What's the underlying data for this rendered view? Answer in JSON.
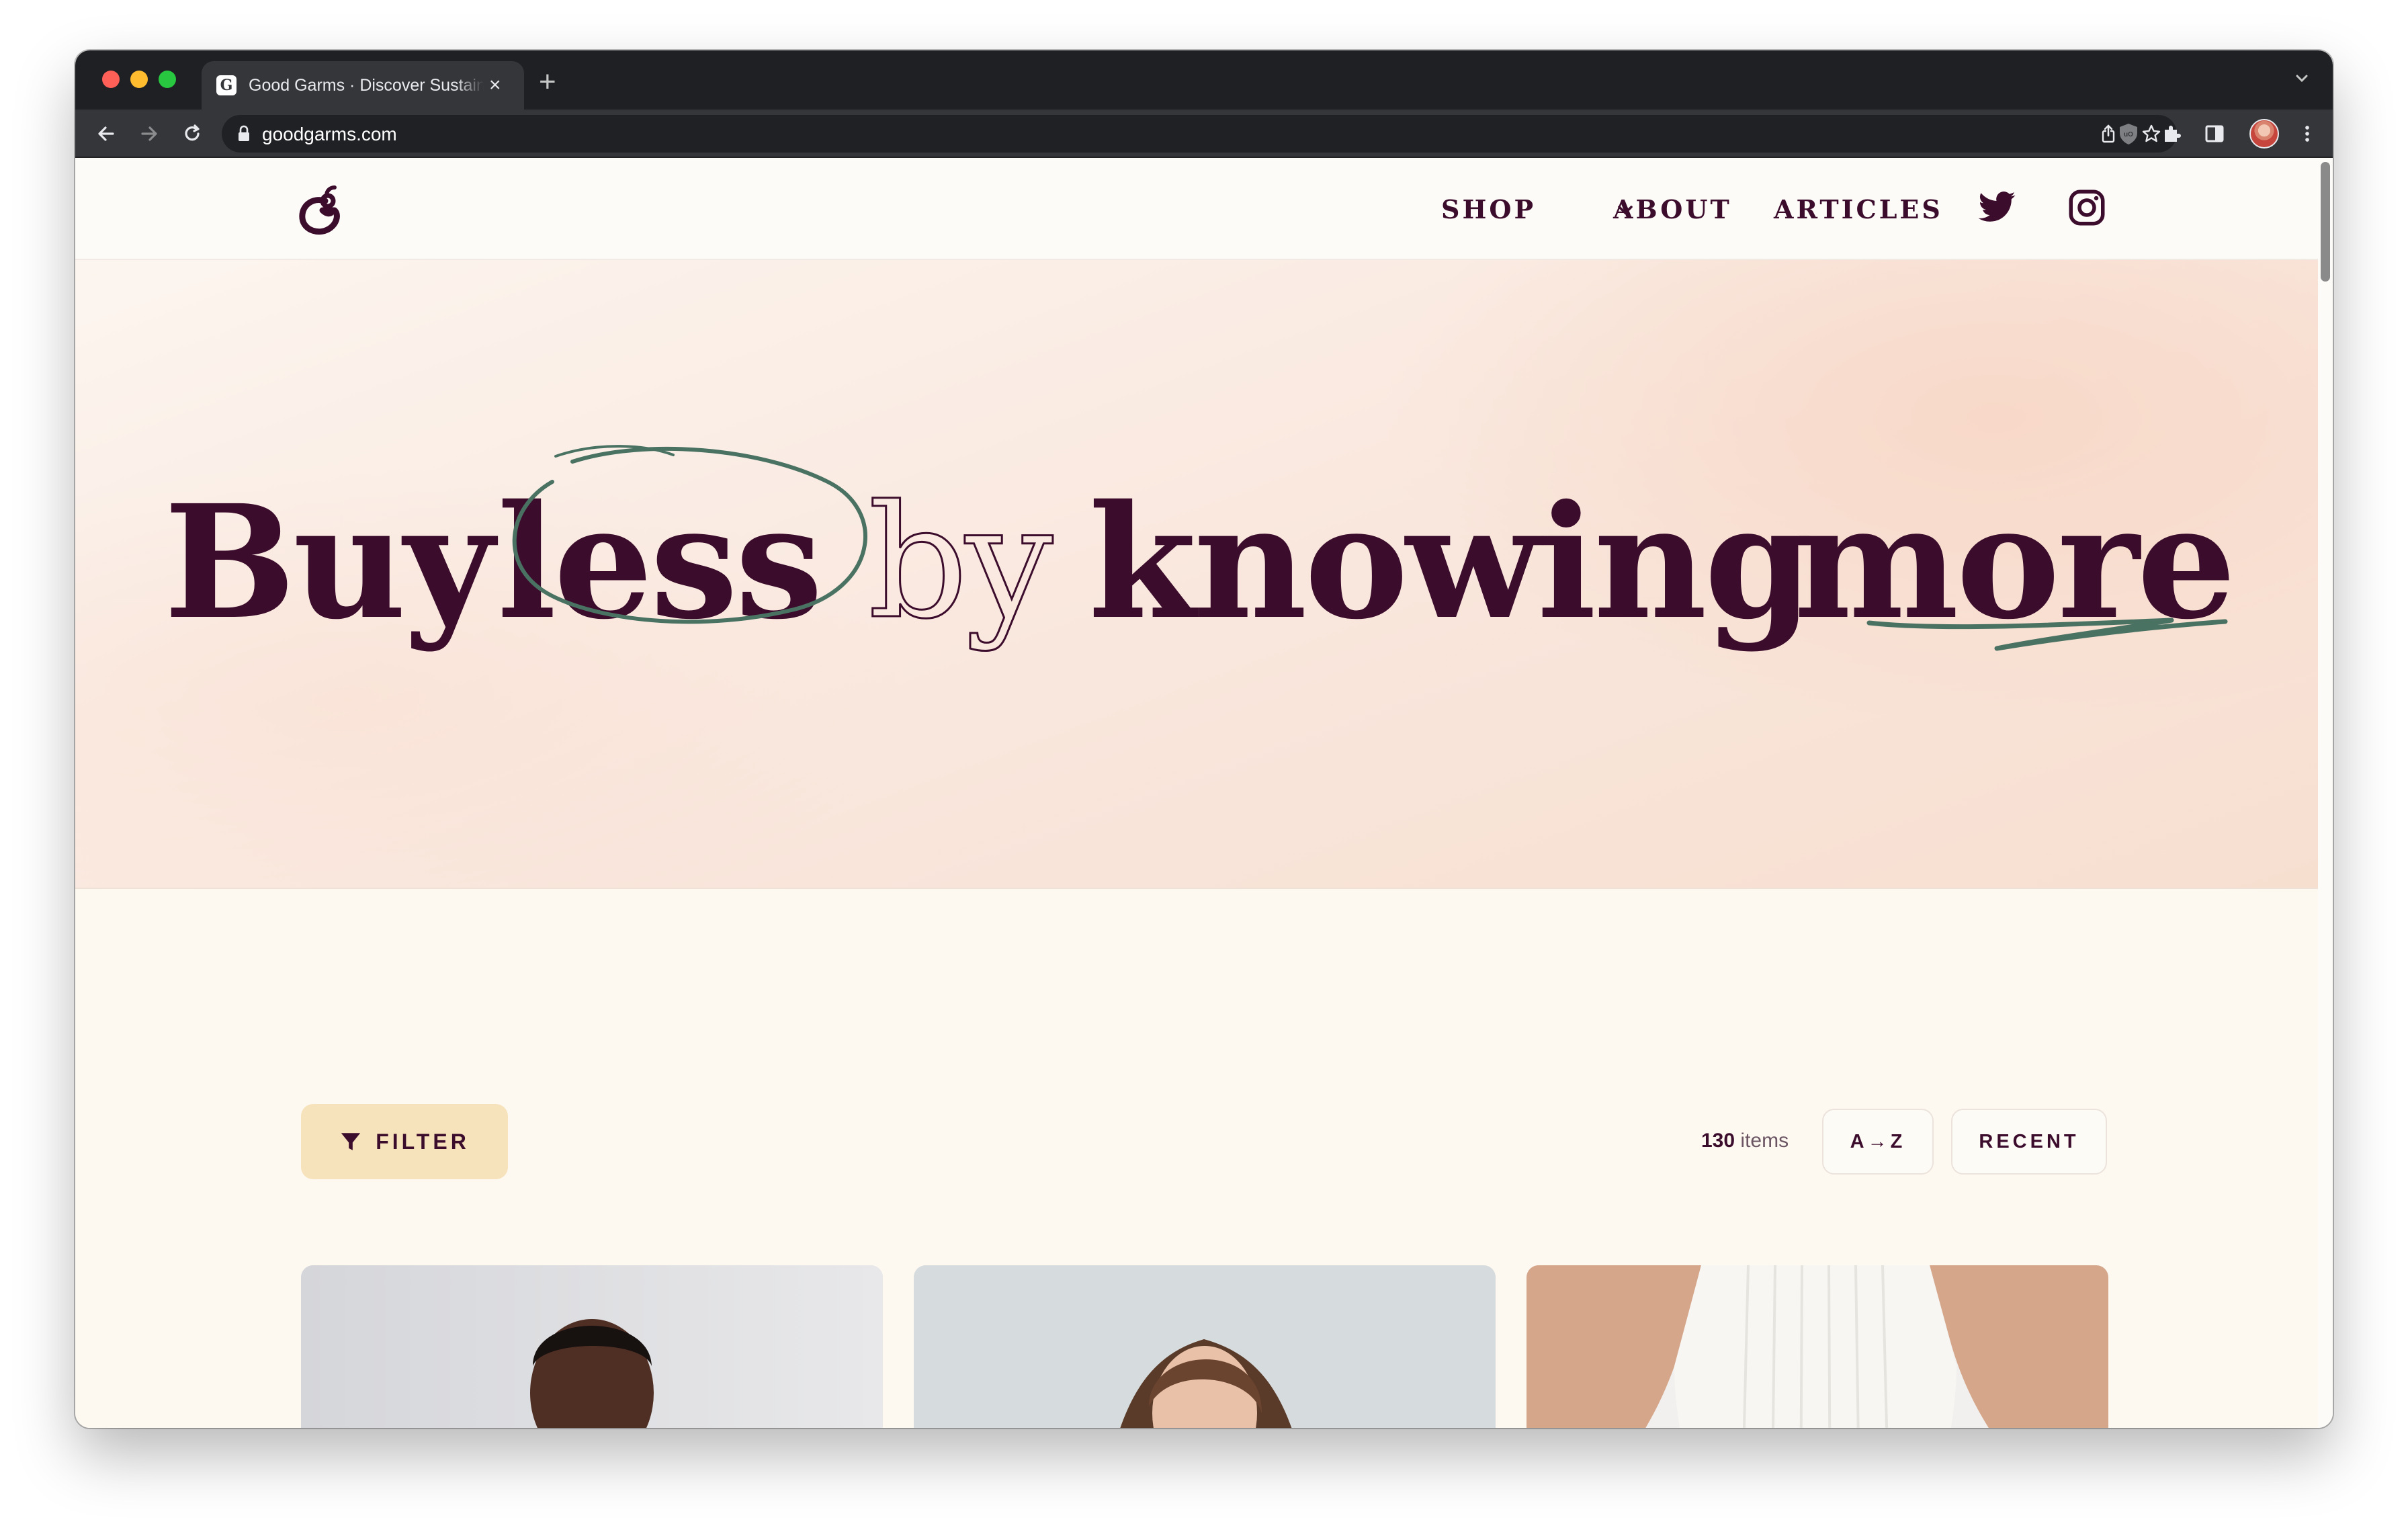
{
  "browser": {
    "tab_title": "Good Garms · Discover Sustainable Fashion",
    "url": "goodgarms.com"
  },
  "nav": {
    "shop": "SHOP",
    "about": "ABOUT",
    "articles": "ARTICLES"
  },
  "hero": {
    "words": [
      "Buy",
      "less",
      "by",
      "knowing",
      "more"
    ]
  },
  "products": {
    "filter_label": "FILTER",
    "count_number": "130",
    "count_label": "items",
    "sort_az": "A→Z",
    "sort_recent": "RECENT"
  },
  "icons": {
    "tab_favicon": "G",
    "logo": "good-garms-logo-icon",
    "twitter": "twitter-icon",
    "instagram": "instagram-icon",
    "filter": "funnel-icon"
  },
  "colors": {
    "brand_text": "#3c0c2c",
    "accent_scribble": "#4a7263",
    "filter_bg": "#f7e3bb"
  }
}
